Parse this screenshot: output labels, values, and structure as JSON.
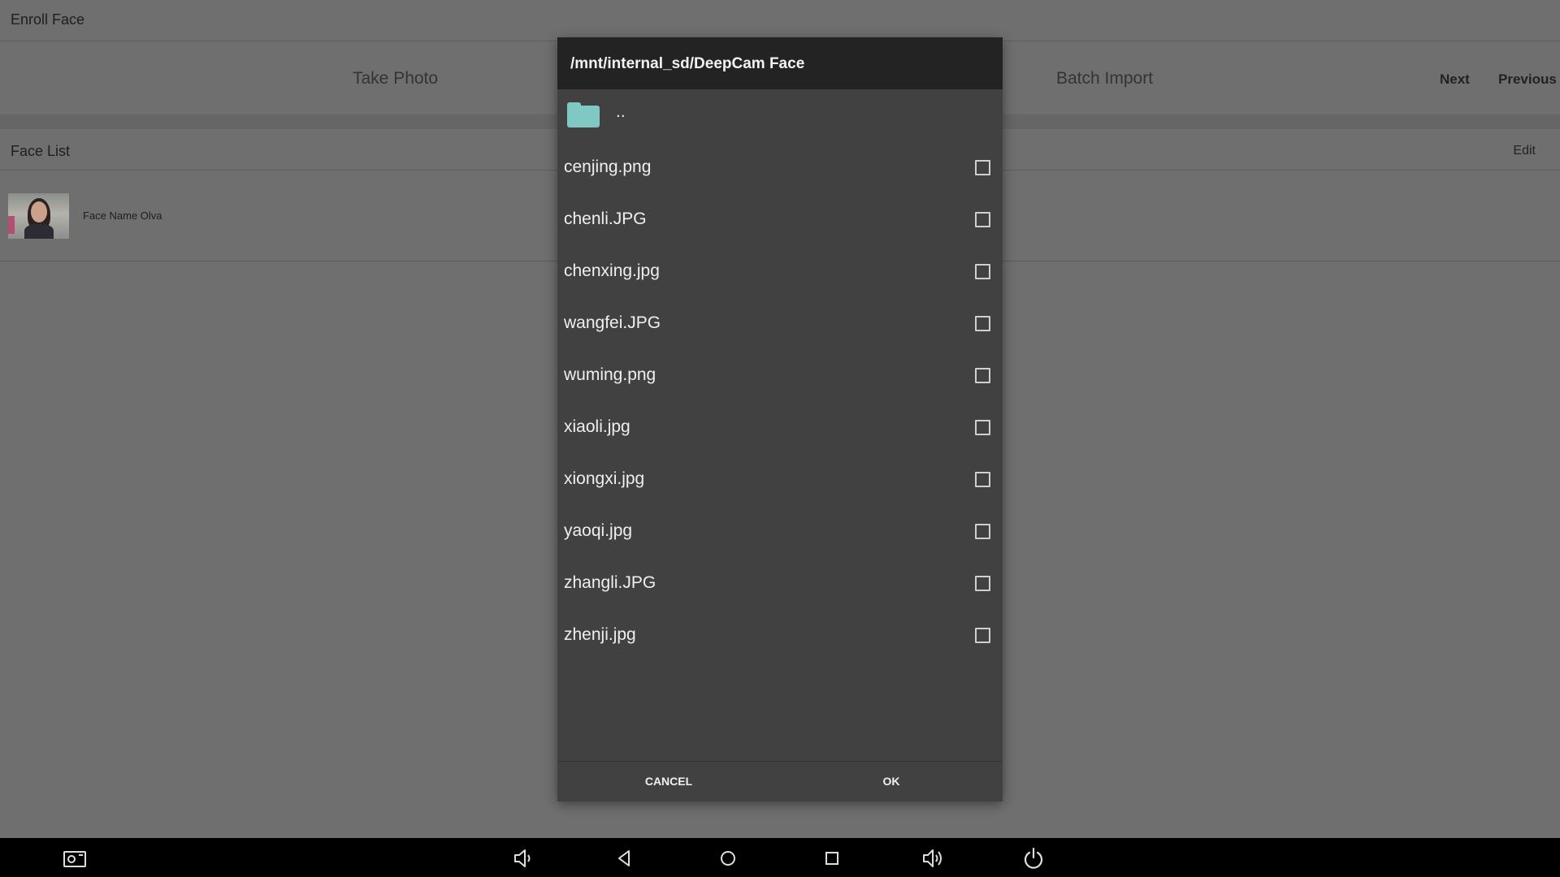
{
  "app": {
    "title": "Enroll Face",
    "tabs": {
      "take_photo": "Take Photo",
      "batch_import": "Batch Import"
    },
    "nav": {
      "next": "Next",
      "previous": "Previous"
    },
    "face_list": {
      "title": "Face List",
      "edit_label": "Edit",
      "items": [
        {
          "name": "Face Name Olva"
        }
      ]
    }
  },
  "dialog": {
    "path": "/mnt/internal_sd/DeepCam Face",
    "parent_label": "..",
    "folder_icon": "folder-icon",
    "files": [
      {
        "name": "cenjing.png",
        "checked": false
      },
      {
        "name": "chenli.JPG",
        "checked": false
      },
      {
        "name": "chenxing.jpg",
        "checked": false
      },
      {
        "name": "wangfei.JPG",
        "checked": false
      },
      {
        "name": "wuming.png",
        "checked": false
      },
      {
        "name": "xiaoli.jpg",
        "checked": false
      },
      {
        "name": "xiongxi.jpg",
        "checked": false
      },
      {
        "name": "yaoqi.jpg",
        "checked": false
      },
      {
        "name": "zhangli.JPG",
        "checked": false
      },
      {
        "name": "zhenji.jpg",
        "checked": false
      }
    ],
    "cancel_label": "CANCEL",
    "ok_label": "OK"
  },
  "system_bar": {
    "icons": [
      "screenshot-icon",
      "volume-down-icon",
      "back-icon",
      "home-icon",
      "recents-icon",
      "volume-up-icon",
      "power-icon"
    ]
  },
  "colors": {
    "folder": "#7fc8c4",
    "dialog_bg": "#414141",
    "dialog_header": "#232323",
    "app_bg": "#6f6f6f"
  }
}
